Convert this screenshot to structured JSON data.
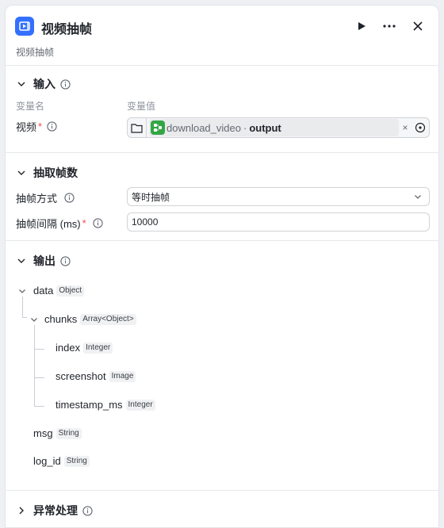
{
  "header": {
    "title": "视频抽帧",
    "subtitle": "视频抽帧"
  },
  "input_section": {
    "title": "输入",
    "col_name": "变量名",
    "col_value": "变量值",
    "field_label": "视频",
    "ref_node": "download_video",
    "ref_sep": "·",
    "ref_var": "output",
    "clear": "×"
  },
  "extract_section": {
    "title": "抽取帧数",
    "mode_label": "抽帧方式",
    "mode_value": "等时抽帧",
    "interval_label": "抽帧间隔 (ms)",
    "interval_value": "10000"
  },
  "output_section": {
    "title": "输出",
    "tree": {
      "data": {
        "name": "data",
        "type": "Object"
      },
      "chunks": {
        "name": "chunks",
        "type": "Array<Object>"
      },
      "index": {
        "name": "index",
        "type": "Integer"
      },
      "screenshot": {
        "name": "screenshot",
        "type": "Image"
      },
      "timestamp": {
        "name": "timestamp_ms",
        "type": "Integer"
      },
      "msg": {
        "name": "msg",
        "type": "String"
      },
      "log_id": {
        "name": "log_id",
        "type": "String"
      }
    }
  },
  "error_section": {
    "title": "异常处理"
  },
  "colors": {
    "accent": "#3370ff",
    "node_green": "#32a645",
    "required": "#f54a45"
  }
}
